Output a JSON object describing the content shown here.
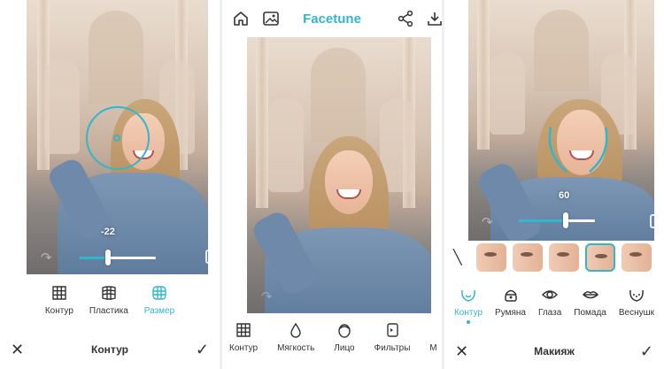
{
  "colors": {
    "accent": "#32b6cc",
    "text": "#333333",
    "background": "#ffffff"
  },
  "panel1": {
    "slider_value": "-22",
    "tools": [
      {
        "label": "Контур",
        "icon": "grid-warp-icon",
        "active": false
      },
      {
        "label": "Пластика",
        "icon": "grid-reshape-icon",
        "active": false
      },
      {
        "label": "Размер",
        "icon": "grid-size-icon",
        "active": true
      }
    ],
    "bottom_bar": {
      "title": "Контур",
      "cancel_icon": "close-icon",
      "apply_icon": "check-icon"
    }
  },
  "panel2": {
    "app_title": "Facetune",
    "header_icons": [
      "home-icon",
      "gallery-icon",
      "share-icon",
      "download-icon"
    ],
    "tools": [
      {
        "label": "Контур",
        "icon": "grid-warp-icon"
      },
      {
        "label": "Мягкость",
        "icon": "drop-icon"
      },
      {
        "label": "Лицо",
        "icon": "face-icon"
      },
      {
        "label": "Фильтры",
        "icon": "filters-icon"
      },
      {
        "label": "М",
        "icon": ""
      }
    ]
  },
  "panel3": {
    "slider_value": "60",
    "tools": [
      {
        "label": "Контур",
        "icon": "contour-face-icon",
        "active": true
      },
      {
        "label": "Румяна",
        "icon": "blush-icon",
        "active": false
      },
      {
        "label": "Глаза",
        "icon": "eye-icon",
        "active": false
      },
      {
        "label": "Помада",
        "icon": "lips-icon",
        "active": false
      },
      {
        "label": "Веснушк",
        "icon": "freckles-icon",
        "active": false
      }
    ],
    "bottom_bar": {
      "title": "Макияж",
      "cancel_icon": "close-icon",
      "apply_icon": "check-icon"
    }
  }
}
